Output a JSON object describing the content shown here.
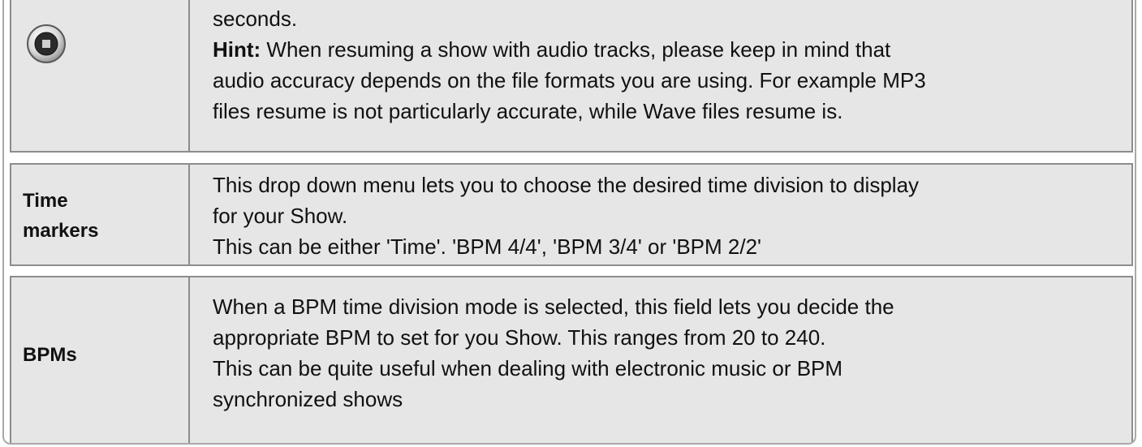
{
  "rows": [
    {
      "icon": "stop-circle-icon",
      "label": "",
      "lines": [
        "seconds.",
        {
          "bold": "Hint:",
          "rest": " When resuming a show with audio tracks, please keep in mind that"
        },
        "audio accuracy depends on the file formats you are using. For example MP3",
        "files resume is not particularly accurate, while Wave files resume is."
      ]
    },
    {
      "label_line1": "Time",
      "label_line2": "markers",
      "lines": [
        "This drop down menu lets you to choose the desired time division to display",
        "for your Show.",
        "This can be either 'Time'. 'BPM 4/4', 'BPM 3/4' or 'BPM 2/2'"
      ]
    },
    {
      "label_line1": "BPMs",
      "lines": [
        "When a BPM time division mode is selected, this field lets you decide the",
        "appropriate BPM to set for you Show. This ranges from 20 to 240.",
        "This can be quite useful when dealing with electronic music or BPM",
        "synchronized shows"
      ]
    }
  ]
}
